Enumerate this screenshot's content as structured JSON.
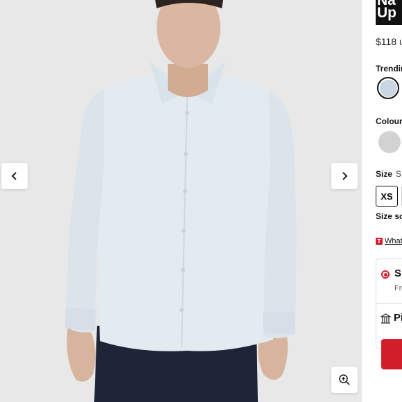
{
  "product": {
    "title_line1": "Na",
    "title_line2": "Up",
    "price": "$118",
    "currency": "U"
  },
  "gallery": {
    "prev_icon": "chevron-left-icon",
    "next_icon": "chevron-right-icon",
    "zoom_icon": "zoom-in-icon"
  },
  "trending": {
    "label": "Trendin",
    "swatch_color": "#c9d7e3"
  },
  "colours": {
    "label": "Colours",
    "swatch_color": "#d2d2d2"
  },
  "size": {
    "label": "Size",
    "selected": "S",
    "options": [
      "XS"
    ],
    "sold_label": "Size so"
  },
  "whats_new": {
    "icon_text": "T",
    "label": "What"
  },
  "shipping": {
    "ship_label": "S",
    "ship_sub": "Fr",
    "pickup_label": "Pi"
  },
  "colors": {
    "accent": "#d31f2b",
    "shirt": "#e4ebf0"
  }
}
